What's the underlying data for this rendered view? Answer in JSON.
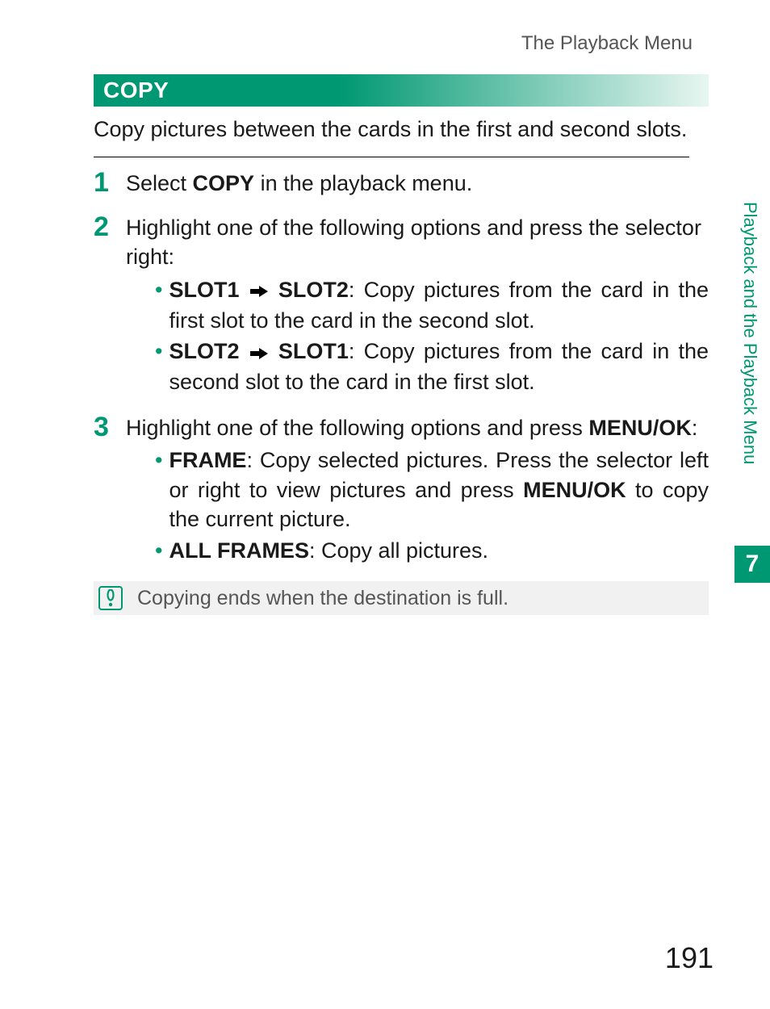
{
  "running_head": "The Playback Menu",
  "section_title": "COPY",
  "intro": "Copy pictures between the cards in the first and second slots.",
  "steps": [
    {
      "num": "1",
      "text_pre": "Select ",
      "text_bold": "COPY",
      "text_post": " in the playback menu."
    },
    {
      "num": "2",
      "text": "Highlight one of the following options and press the selector right:",
      "bullets": [
        {
          "label_a": "SLOT1",
          "label_b": "SLOT2",
          "desc": ": Copy pictures from the card in the first slot to the card in the second slot."
        },
        {
          "label_a": "SLOT2",
          "label_b": "SLOT1",
          "desc": ": Copy pictures from the card in the second slot to the card in the first slot."
        }
      ]
    },
    {
      "num": "3",
      "text_pre": "Highlight one of the following options and press ",
      "text_bold": "MENU/OK",
      "text_post": ":",
      "bullets": [
        {
          "label": "FRAME",
          "desc_pre": ": Copy selected pictures. Press the selector left or right to view pictures and press ",
          "desc_bold": "MENU/OK",
          "desc_post": " to copy the current picture."
        },
        {
          "label": "ALL FRAMES",
          "desc": ": Copy all pictures."
        }
      ]
    }
  ],
  "note_text": "Copying ends when the destination is full.",
  "side_label": "Playback and the Playback Menu",
  "side_chapter": "7",
  "page_number": "191"
}
